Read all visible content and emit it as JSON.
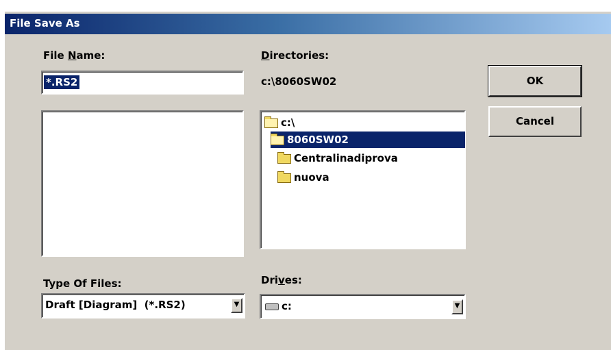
{
  "window": {
    "title": "File Save As"
  },
  "file_name": {
    "label_pre": "File ",
    "label_accel": "N",
    "label_post": "ame:",
    "value": "*.RS2"
  },
  "directories": {
    "label_accel": "D",
    "label_post": "irectories:",
    "current_path": "c:\\8060SW02",
    "items": [
      {
        "name": "c:\\"
      },
      {
        "name": "8060SW02"
      },
      {
        "name": "Centralinadiprova"
      },
      {
        "name": "nuova"
      }
    ]
  },
  "buttons": {
    "ok": "OK",
    "cancel": "Cancel"
  },
  "type_of_files": {
    "label": "Type Of Files:",
    "value": "Draft [Diagram]  (*.RS2)"
  },
  "drives": {
    "label_pre": "Dri",
    "label_accel": "v",
    "label_post": "es:",
    "value": "c:"
  }
}
